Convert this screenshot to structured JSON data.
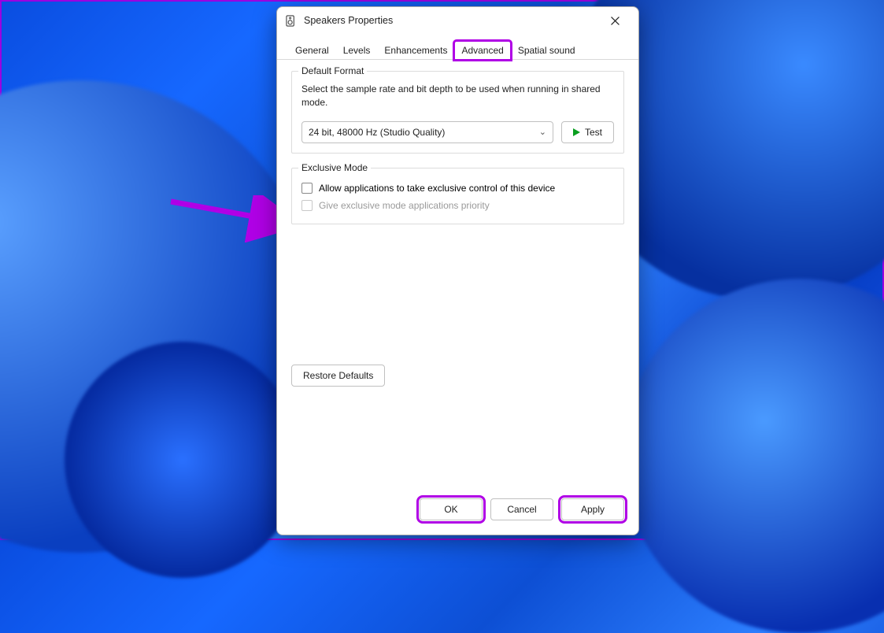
{
  "window": {
    "title": "Speakers Properties"
  },
  "tabs": {
    "general": "General",
    "levels": "Levels",
    "enhancements": "Enhancements",
    "advanced": "Advanced",
    "spatial": "Spatial sound"
  },
  "defaultFormat": {
    "groupTitle": "Default Format",
    "help": "Select the sample rate and bit depth to be used when running in shared mode.",
    "selected": "24 bit, 48000 Hz (Studio Quality)",
    "testLabel": "Test"
  },
  "exclusiveMode": {
    "groupTitle": "Exclusive Mode",
    "allowControl": "Allow applications to take exclusive control of this device",
    "givePriority": "Give exclusive mode applications priority"
  },
  "buttons": {
    "restoreDefaults": "Restore Defaults",
    "ok": "OK",
    "cancel": "Cancel",
    "apply": "Apply"
  }
}
